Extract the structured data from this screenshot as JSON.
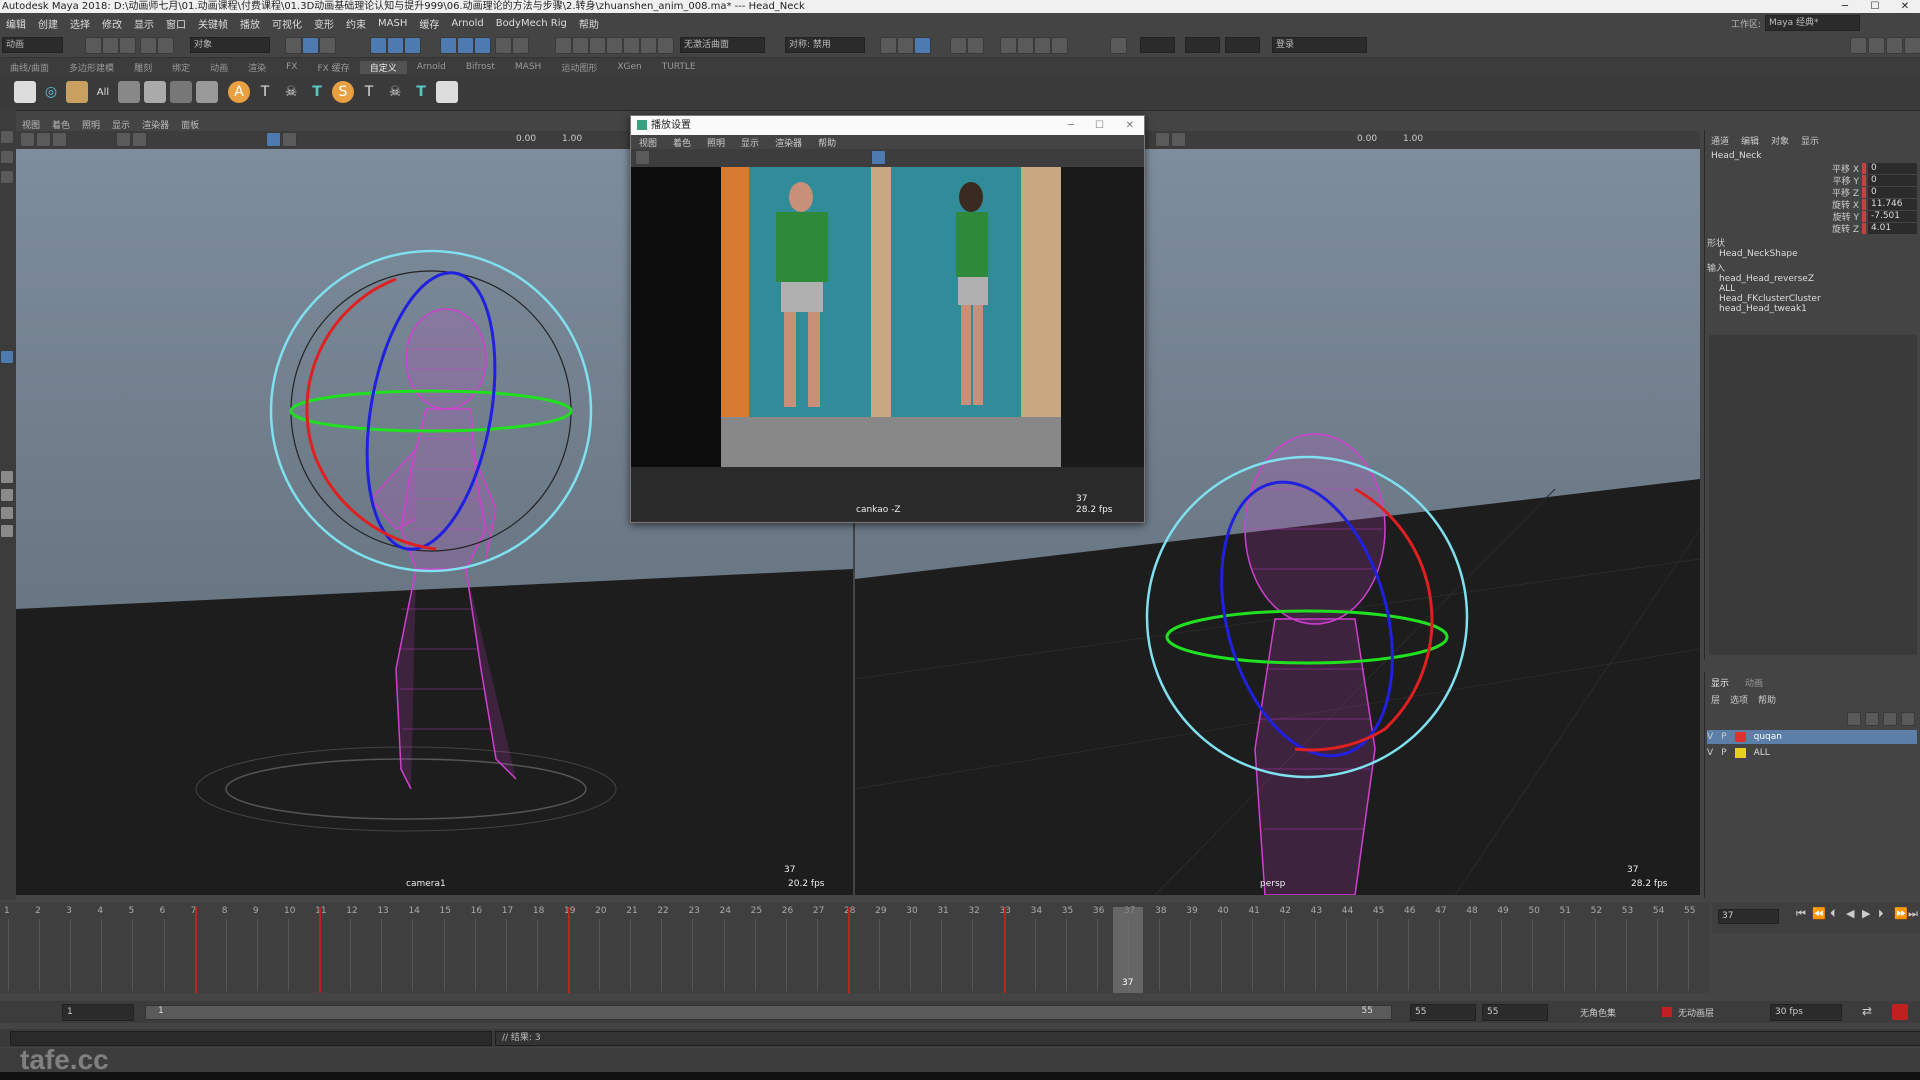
{
  "window": {
    "title": "Autodesk Maya 2018: D:\\动画师七月\\01.动画课程\\付费课程\\01.3D动画基础理论认知与提升999\\06.动画理论的方法与步骤\\2.转身\\zhuanshen_anim_008.ma*  ---  Head_Neck",
    "minimize": "─",
    "maximize": "☐",
    "close": "✕"
  },
  "menubar": {
    "items": [
      "编辑",
      "创建",
      "选择",
      "修改",
      "显示",
      "窗口",
      "关键帧",
      "播放",
      "可视化",
      "变形",
      "约束",
      "MASH",
      "缓存",
      "Arnold",
      "BodyMech Rig",
      "帮助"
    ],
    "workspace_label": "工作区:",
    "workspace_value": "Maya 经典*"
  },
  "statusline": {
    "mode_field": "动画",
    "object_field": "对象",
    "symmetry_field": "对称: 禁用",
    "live_field": "无激活曲面",
    "login": "登录"
  },
  "shelf_tabs": [
    "曲线/曲面",
    "多边形建模",
    "雕刻",
    "绑定",
    "动画",
    "渲染",
    "FX",
    "FX 缓存",
    "自定义",
    "Arnold",
    "Bifrost",
    "MASH",
    "运动图形",
    "XGen",
    "TURTLE"
  ],
  "shelf_active_tab": "自定义",
  "left_viewport": {
    "menu": [
      "视图",
      "着色",
      "照明",
      "显示",
      "渲染器",
      "面板"
    ],
    "toolbar_values": [
      "0.00",
      "1.00"
    ],
    "camera_label": "camera1",
    "frame": "37",
    "fps": "20.2 fps"
  },
  "right_viewport": {
    "toolbar_values": [
      "0.00",
      "1.00"
    ],
    "camera_label": "persp",
    "frame": "37",
    "fps": "28.2 fps"
  },
  "float_window": {
    "title": "播放设置",
    "menu": [
      "视图",
      "着色",
      "照明",
      "显示",
      "渲染器",
      "帮助"
    ],
    "camera_label": "cankao -Z",
    "frame": "37",
    "fps": "28.2 fps"
  },
  "channel_box": {
    "tabs": [
      "通道",
      "编辑",
      "对象",
      "显示"
    ],
    "object": "Head_Neck",
    "attributes": [
      {
        "label": "平移 X",
        "value": "0"
      },
      {
        "label": "平移 Y",
        "value": "0"
      },
      {
        "label": "平移 Z",
        "value": "0"
      },
      {
        "label": "旋转 X",
        "value": "11.746"
      },
      {
        "label": "旋转 Y",
        "value": "-7.501"
      },
      {
        "label": "旋转 Z",
        "value": "4.01"
      }
    ],
    "shapes_label": "形状",
    "shape_name": "Head_NeckShape",
    "inputs_label": "输入",
    "inputs": [
      "head_Head_reverseZ",
      "ALL",
      "Head_FKclusterCluster",
      "head_Head_tweak1"
    ]
  },
  "layer_editor": {
    "tabs": [
      "显示",
      "动画"
    ],
    "menu": [
      "层",
      "选项",
      "帮助"
    ],
    "layers": [
      {
        "v": "V",
        "p": "P",
        "color": "#e03030",
        "name": "quqan",
        "selected": true
      },
      {
        "v": "V",
        "p": "P",
        "color": "#e8d020",
        "name": "ALL",
        "selected": false
      }
    ]
  },
  "timeline": {
    "ticks": [
      "1",
      "2",
      "3",
      "4",
      "5",
      "6",
      "7",
      "8",
      "9",
      "10",
      "11",
      "12",
      "13",
      "14",
      "15",
      "16",
      "17",
      "18",
      "19",
      "20",
      "21",
      "22",
      "23",
      "24",
      "25",
      "26",
      "27",
      "28",
      "29",
      "30",
      "31",
      "32",
      "33",
      "34",
      "35",
      "36",
      "37",
      "38",
      "39",
      "40",
      "41",
      "42",
      "43",
      "44",
      "45",
      "46",
      "47",
      "48",
      "49",
      "50",
      "51",
      "52",
      "53",
      "54",
      "55"
    ],
    "keyframes": [
      7,
      11,
      19,
      28,
      33
    ],
    "current_frame": "37",
    "current_frame_field": "37"
  },
  "range": {
    "start": "1",
    "inner_start": "1",
    "inner_end": "55",
    "end1": "55",
    "end2": "55",
    "char_set": "无角色集",
    "anim_layer": "无动画层",
    "fps": "30 fps"
  },
  "command_line": {
    "result": "// 结果: 3"
  },
  "help_line": {
    "text": "tafe.cc"
  },
  "colors": {
    "viewport_top": "#7d8c9c",
    "viewport_bottom": "#5a6673",
    "ground": "#1c1c1c",
    "mesh": "#d040d0",
    "manip_outer": "#7fe0f0",
    "manip_x": "#e02020",
    "manip_y": "#20e020",
    "manip_z": "#2020e0",
    "key": "#c02020"
  }
}
